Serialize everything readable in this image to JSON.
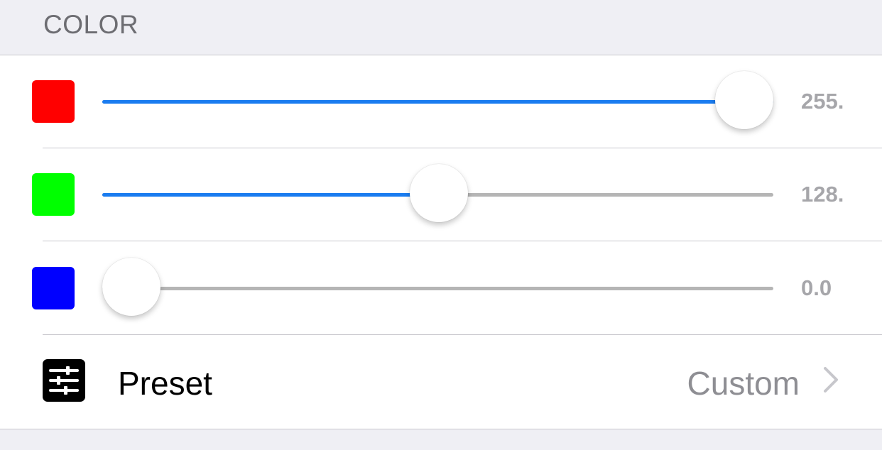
{
  "section": {
    "title": "COLOR"
  },
  "sliders": [
    {
      "name": "red",
      "color": "#ff0000",
      "value_label": "255.",
      "level": 1.0
    },
    {
      "name": "green",
      "color": "#00ff00",
      "value_label": "128.",
      "level": 0.502
    },
    {
      "name": "blue",
      "color": "#0000ff",
      "value_label": "0.0",
      "level": 0.0
    }
  ],
  "accent_color": "#1a7cf0",
  "preset": {
    "label": "Preset",
    "value": "Custom",
    "icon": "sliders-icon",
    "chevron_icon": "chevron-right-icon"
  }
}
